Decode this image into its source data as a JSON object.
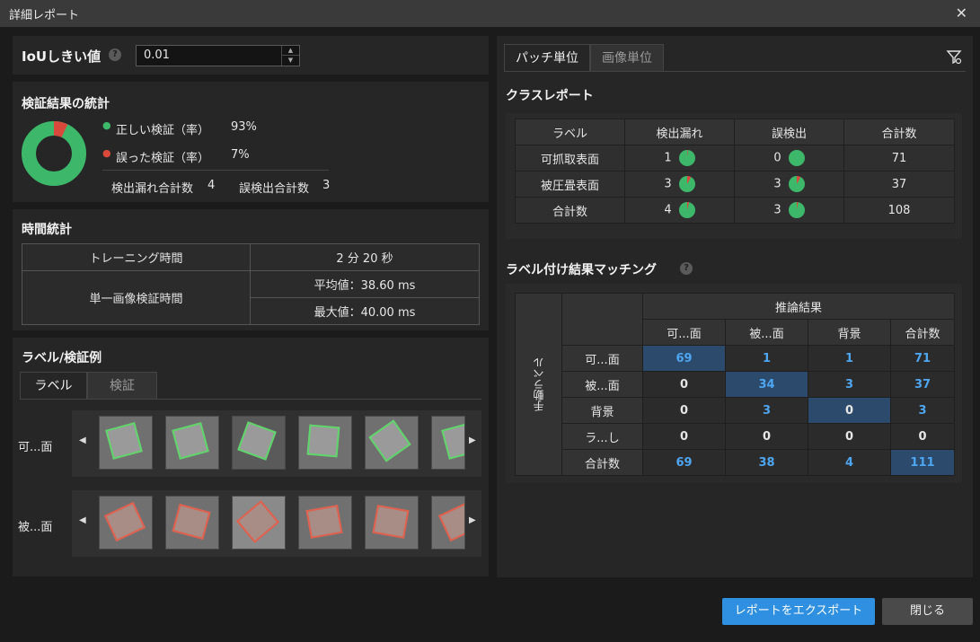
{
  "window": {
    "title": "詳細レポート"
  },
  "iou": {
    "label": "IoUしきい値",
    "value": "0.01"
  },
  "stats": {
    "title": "検証結果の統計",
    "correct_label": "正しい検証（率）",
    "correct_value": "93%",
    "wrong_label": "誤った検証（率）",
    "wrong_value": "7%",
    "missed_total_label": "検出漏れ合計数",
    "missed_total_value": "4",
    "false_total_label": "誤検出合計数",
    "false_total_value": "3",
    "correct_rate": 0.93,
    "colors": {
      "correct": "#3db86b",
      "wrong": "#d9493b"
    }
  },
  "time": {
    "title": "時間統計",
    "training_label": "トレーニング時間",
    "training_value": "2 分 20 秒",
    "single_label": "単一画像検証時間",
    "avg": "平均値：38.60 ms",
    "max": "最大値：40.00 ms"
  },
  "examples": {
    "title": "ラベル/検証例",
    "tab_label": "ラベル",
    "tab_verify": "検証",
    "row1_label": "可...面",
    "row2_label": "被...面"
  },
  "right_tabs": {
    "patch": "パッチ単位",
    "image": "画像単位"
  },
  "class_report": {
    "title": "クラスレポート",
    "headers": [
      "ラベル",
      "検出漏れ",
      "誤検出",
      "合計数"
    ],
    "rows": [
      {
        "label": "可抓取表面",
        "missed": "1",
        "false": "0",
        "total": "71",
        "missed_rate": 0.014,
        "false_rate": 0.0
      },
      {
        "label": "被圧畳表面",
        "missed": "3",
        "false": "3",
        "total": "37",
        "missed_rate": 0.08,
        "false_rate": 0.08
      },
      {
        "label": "合計数",
        "missed": "4",
        "false": "3",
        "total": "108",
        "missed_rate": 0.037,
        "false_rate": 0.028
      }
    ]
  },
  "matching": {
    "title": "ラベル付け結果マッチング",
    "inference_header": "推論結果",
    "manual_header": "手動ラベル",
    "col_headers": [
      "可...面",
      "被...面",
      "背景",
      "合計数"
    ],
    "rows": [
      {
        "label": "可...面",
        "cells": [
          "69",
          "1",
          "1",
          "71"
        ]
      },
      {
        "label": "被...面",
        "cells": [
          "0",
          "34",
          "3",
          "37"
        ]
      },
      {
        "label": "背景",
        "cells": [
          "0",
          "3",
          "0",
          "3"
        ]
      },
      {
        "label": "ラ...し",
        "cells": [
          "0",
          "0",
          "0",
          "0"
        ]
      },
      {
        "label": "合計数",
        "cells": [
          "69",
          "38",
          "4",
          "111"
        ]
      }
    ]
  },
  "buttons": {
    "export": "レポートをエクスポート",
    "close": "閉じる"
  }
}
